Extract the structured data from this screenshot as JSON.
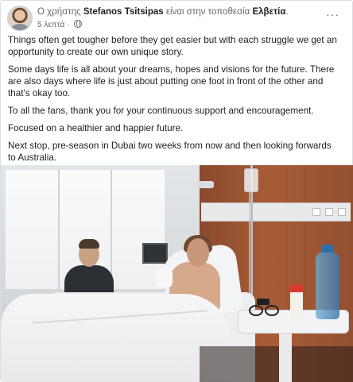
{
  "post": {
    "author_prefix": "Ο χρήστης ",
    "author_name": "Stefanos Tsitsipas",
    "location_prefix": " είναι στην τοποθεσία ",
    "location_name": "Ελβετία",
    "location_suffix": ".",
    "timestamp": "5 λεπτά ·",
    "privacy_icon": "globe-icon",
    "more_label": "···",
    "paragraphs": [
      "Things often get tougher before they get easier but with each struggle we get an opportunity to create our own unique story.",
      "Some days life is all about your dreams, hopes and visions for the future. There are also days where life is just about putting one foot in front of the other and that's okay too.",
      "To all the fans, thank you for your continuous support and encouragement.",
      "Focused on a healthier and happier future.",
      "Next stop, pre-season in Dubai two weeks from now and then looking forwards to Australia."
    ]
  }
}
